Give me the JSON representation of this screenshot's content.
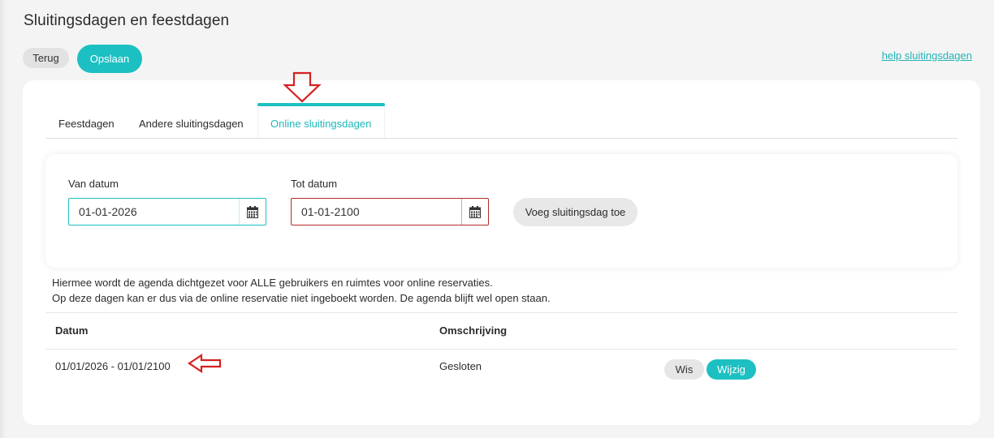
{
  "page": {
    "title": "Sluitingsdagen en feestdagen"
  },
  "toolbar": {
    "back_label": "Terug",
    "save_label": "Opslaan",
    "help_link": "help sluitingsdagen"
  },
  "tabs": [
    {
      "label": "Feestdagen",
      "active": false
    },
    {
      "label": "Andere sluitingsdagen",
      "active": false
    },
    {
      "label": "Online sluitingsdagen",
      "active": true
    }
  ],
  "form": {
    "from_label": "Van datum",
    "from_value": "01-01-2026",
    "to_label": "Tot datum",
    "to_value": "01-01-2100",
    "add_button": "Voeg sluitingsdag toe"
  },
  "info": {
    "line1": "Hiermee wordt de agenda dichtgezet voor ALLE gebruikers en ruimtes voor online reservaties.",
    "line2": "Op deze dagen kan er dus via de online reservatie niet ingeboekt worden. De agenda blijft wel open staan."
  },
  "table": {
    "headers": {
      "date": "Datum",
      "description": "Omschrijving"
    },
    "rows": [
      {
        "date": "01/01/2026 - 01/01/2100",
        "description": "Gesloten",
        "delete_label": "Wis",
        "edit_label": "Wijzig"
      }
    ]
  },
  "colors": {
    "accent": "#1cc0c2",
    "error_border": "#b52a2a",
    "annotation_arrow": "#d42020"
  },
  "icons": {
    "calendar": "calendar-icon",
    "annotation_down": "arrow-down-annotation-icon",
    "annotation_left": "arrow-left-annotation-icon"
  }
}
